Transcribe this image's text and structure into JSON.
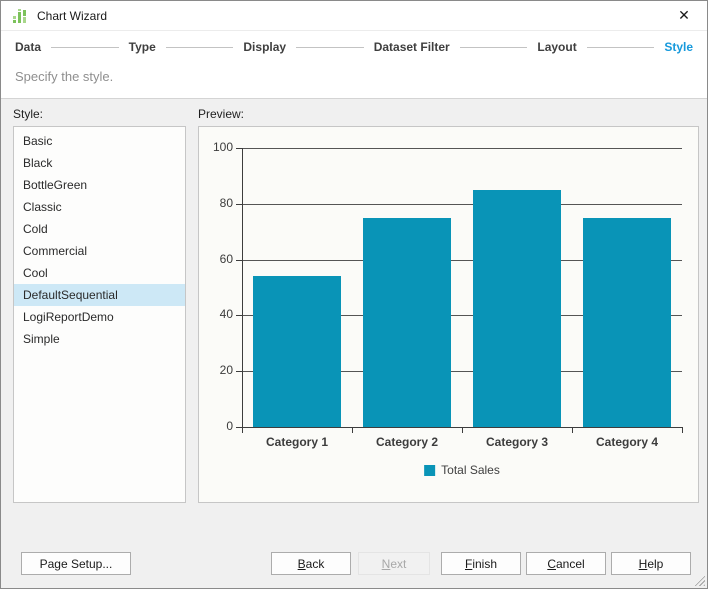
{
  "window": {
    "title": "Chart Wizard",
    "close_glyph": "✕"
  },
  "steps": {
    "items": [
      {
        "label": "Data",
        "active": false
      },
      {
        "label": "Type",
        "active": false
      },
      {
        "label": "Display",
        "active": false
      },
      {
        "label": "Dataset Filter",
        "active": false
      },
      {
        "label": "Layout",
        "active": false
      },
      {
        "label": "Style",
        "active": true
      }
    ]
  },
  "subtitle": "Specify the style.",
  "style_panel": {
    "label": "Style:",
    "items": [
      "Basic",
      "Black",
      "BottleGreen",
      "Classic",
      "Cold",
      "Commercial",
      "Cool",
      "DefaultSequential",
      "LogiReportDemo",
      "Simple"
    ],
    "selected": "DefaultSequential",
    "selected_bg": "#cde8f6"
  },
  "preview_panel": {
    "label": "Preview:"
  },
  "chart_data": {
    "type": "bar",
    "categories": [
      "Category 1",
      "Category 2",
      "Category 3",
      "Category 4"
    ],
    "series": [
      {
        "name": "Total Sales",
        "values": [
          54,
          75,
          85,
          75
        ],
        "color": "#0994b7"
      }
    ],
    "title": "",
    "xlabel": "",
    "ylabel": "",
    "ylim": [
      0,
      100
    ],
    "yticks": [
      0,
      20,
      40,
      60,
      80,
      100
    ],
    "grid": true,
    "legend_position": "bottom"
  },
  "buttons": {
    "page_setup": {
      "pre": "Page Setup...",
      "key": "",
      "rest": ""
    },
    "back": {
      "pre": "",
      "key": "B",
      "rest": "ack"
    },
    "next": {
      "pre": "",
      "key": "N",
      "rest": "ext",
      "disabled": true
    },
    "finish": {
      "pre": "",
      "key": "F",
      "rest": "inish"
    },
    "cancel": {
      "pre": "",
      "key": "C",
      "rest": "ancel"
    },
    "help": {
      "pre": "",
      "key": "H",
      "rest": "elp"
    }
  },
  "accent_colors": {
    "active_step": "#1699dc",
    "bar_teal": "#0994b7",
    "title_icon_green": "#7cc25b"
  }
}
